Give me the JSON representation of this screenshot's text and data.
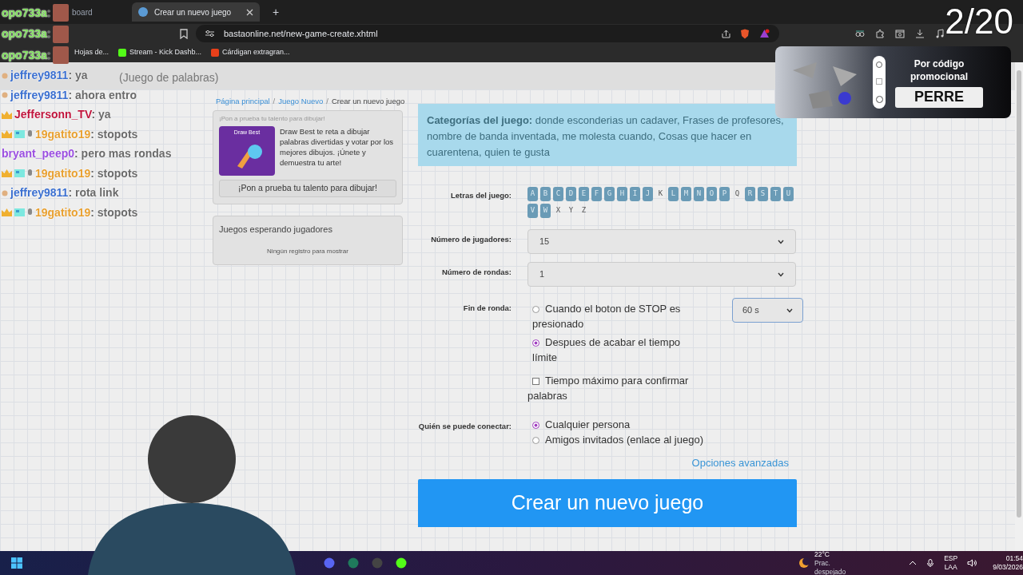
{
  "browser": {
    "tabs": [
      {
        "label": "board",
        "selected": false
      },
      {
        "label": "Crear un nuevo juego",
        "selected": true
      }
    ],
    "new_tab": "+",
    "url": "bastaonline.net/new-game-create.xhtml",
    "bookmarks": [
      "Hojas de...",
      "Stream - Kick Dashb...",
      "Cárdigan extragran..."
    ]
  },
  "page": {
    "subtitle": "(Juego de palabras)",
    "breadcrumb_separator": "/",
    "breadcrumb": [
      {
        "label": "Página principal",
        "kind": "link"
      },
      {
        "label": "Juego Nuevo",
        "kind": "link"
      },
      {
        "label": "Crear un nuevo juego",
        "kind": "current"
      }
    ],
    "promo_card": {
      "heading": "¡Pon a prueba tu talento para dibujar!",
      "image_title": "Draw Best",
      "text": "Draw Best te reta a dibujar palabras divertidas y votar por los mejores dibujos. ¡Únete y demuestra tu arte!",
      "button": "¡Pon a prueba tu talento para dibujar!"
    },
    "waiting": {
      "title": "Juegos esperando jugadores",
      "empty": "Ningún registro para mostrar"
    },
    "categories": "**Categorías del juego:** donde esconderias un cadaver, Frases de profesores, nombre de banda inventada, me molesta cuando, Cosas que hacer en cuarentena, quien te gusta",
    "form": {
      "letters_label": "Letras del juego:",
      "letters": [
        {
          "letter": "A",
          "selected": true
        },
        {
          "letter": "B",
          "selected": true
        },
        {
          "letter": "C",
          "selected": true
        },
        {
          "letter": "D",
          "selected": true
        },
        {
          "letter": "E",
          "selected": true
        },
        {
          "letter": "F",
          "selected": true
        },
        {
          "letter": "G",
          "selected": true
        },
        {
          "letter": "H",
          "selected": true
        },
        {
          "letter": "I",
          "selected": true
        },
        {
          "letter": "J",
          "selected": true
        },
        {
          "letter": "K",
          "selected": false
        },
        {
          "letter": "L",
          "selected": true
        },
        {
          "letter": "M",
          "selected": true
        },
        {
          "letter": "N",
          "selected": true
        },
        {
          "letter": "O",
          "selected": true
        },
        {
          "letter": "P",
          "selected": true
        },
        {
          "letter": "Q",
          "selected": false
        },
        {
          "letter": "R",
          "selected": true
        },
        {
          "letter": "S",
          "selected": true
        },
        {
          "letter": "T",
          "selected": true
        },
        {
          "letter": "U",
          "selected": true
        },
        {
          "letter": "V",
          "selected": true
        },
        {
          "letter": "W",
          "selected": true
        },
        {
          "letter": "X",
          "selected": false
        },
        {
          "letter": "Y",
          "selected": false
        },
        {
          "letter": "Z",
          "selected": false
        }
      ],
      "players_label": "Número de jugadores:",
      "players": "15",
      "rounds_label": "Número de rondas:",
      "rounds": "1",
      "round_end_label": "Fin de ronda:",
      "round_end_options": [
        {
          "label": "Cuando el boton de STOP es presionado",
          "selected": false
        },
        {
          "label": "Despues de acabar el tiempo límite",
          "selected": true
        }
      ],
      "time_limit": "60 s",
      "confirm_time": {
        "label": "Tiempo máximo para confirmar palabras",
        "checked": false
      },
      "who_label": "Quién se puede conectar:",
      "who_options": [
        {
          "label": "Cualquier persona",
          "selected": true
        },
        {
          "label": "Amigos invitados (enlace al juego)",
          "selected": false
        }
      ],
      "advanced": "Opciones avanzadas",
      "submit": "Crear un nuevo juego"
    }
  },
  "overlay": {
    "chat": [
      {
        "kind": "emote",
        "user": "opo733a",
        "color": "#7ddc5a",
        "message": ":"
      },
      {
        "kind": "emote",
        "user": "opo733a",
        "color": "#7ddc5a",
        "message": ":"
      },
      {
        "kind": "emote",
        "user": "opo733a",
        "color": "#7ddc5a",
        "message": ":"
      },
      {
        "kind": "viewer",
        "user": "jeffrey9811",
        "color": "#3a6fd0",
        "message": ": ya"
      },
      {
        "kind": "viewer",
        "user": "jeffrey9811",
        "color": "#3a6fd0",
        "message": ": ahora entro"
      },
      {
        "kind": "vip",
        "user": "Jeffersonn_TV",
        "color": "#c0143c",
        "message": ": ya"
      },
      {
        "kind": "moderator",
        "user": "19gatito19",
        "color": "#e8a030",
        "message": ": stopots"
      },
      {
        "kind": "plain",
        "user": "bryant_peep0",
        "color": "#9a4ee0",
        "message": ": pero mas rondas"
      },
      {
        "kind": "moderator",
        "user": "19gatito19",
        "color": "#e8a030",
        "message": ": stopots"
      },
      {
        "kind": "viewer",
        "user": "jeffrey9811",
        "color": "#3a6fd0",
        "message": ": rota link"
      },
      {
        "kind": "moderator",
        "user": "19gatito19",
        "color": "#e8a030",
        "message": ": stopots"
      }
    ],
    "counter": "2/20",
    "ad": {
      "text": "Por código promocional",
      "code": "PERRE"
    }
  },
  "taskbar": {
    "temperature": "22°C",
    "weather": "Prac. despejado",
    "language": "ESP",
    "layout": "LAA",
    "time": "01:54",
    "date": "9/03/2026"
  }
}
